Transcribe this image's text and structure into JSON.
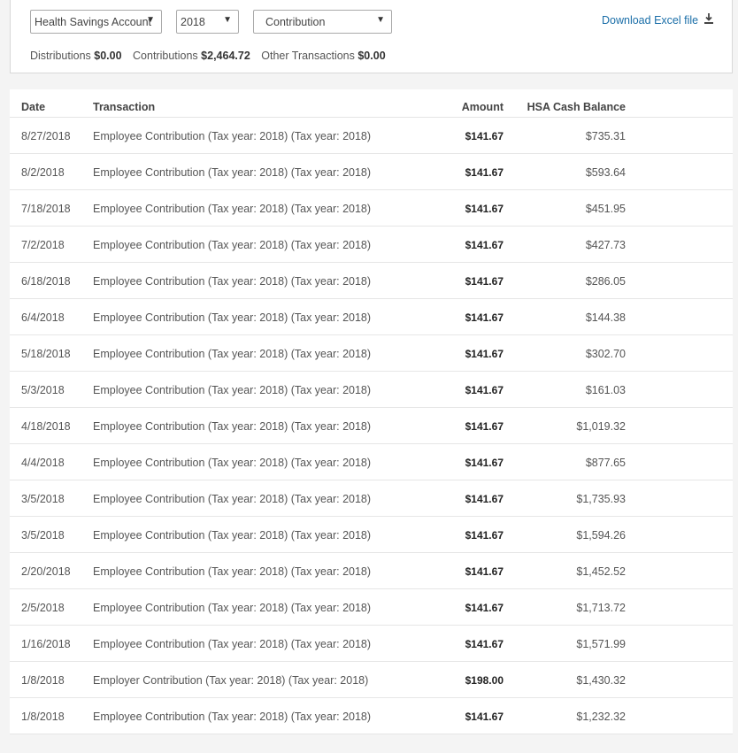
{
  "filters": {
    "account": "Health Savings Account",
    "year": "2018",
    "type": "Contribution"
  },
  "download_label": "Download Excel file",
  "summary": {
    "distributions_label": "Distributions",
    "distributions_value": "$0.00",
    "contributions_label": "Contributions",
    "contributions_value": "$2,464.72",
    "other_label": "Other Transactions",
    "other_value": "$0.00"
  },
  "table": {
    "headers": [
      "Date",
      "Transaction",
      "Amount",
      "HSA Cash Balance"
    ],
    "rows": [
      {
        "date": "8/27/2018",
        "transaction": "Employee Contribution (Tax year: 2018) (Tax year: 2018)",
        "amount": "$141.67",
        "balance": "$735.31"
      },
      {
        "date": "8/2/2018",
        "transaction": "Employee Contribution (Tax year: 2018) (Tax year: 2018)",
        "amount": "$141.67",
        "balance": "$593.64"
      },
      {
        "date": "7/18/2018",
        "transaction": "Employee Contribution (Tax year: 2018) (Tax year: 2018)",
        "amount": "$141.67",
        "balance": "$451.95"
      },
      {
        "date": "7/2/2018",
        "transaction": "Employee Contribution (Tax year: 2018) (Tax year: 2018)",
        "amount": "$141.67",
        "balance": "$427.73"
      },
      {
        "date": "6/18/2018",
        "transaction": "Employee Contribution (Tax year: 2018) (Tax year: 2018)",
        "amount": "$141.67",
        "balance": "$286.05"
      },
      {
        "date": "6/4/2018",
        "transaction": "Employee Contribution (Tax year: 2018) (Tax year: 2018)",
        "amount": "$141.67",
        "balance": "$144.38"
      },
      {
        "date": "5/18/2018",
        "transaction": "Employee Contribution (Tax year: 2018) (Tax year: 2018)",
        "amount": "$141.67",
        "balance": "$302.70"
      },
      {
        "date": "5/3/2018",
        "transaction": "Employee Contribution (Tax year: 2018) (Tax year: 2018)",
        "amount": "$141.67",
        "balance": "$161.03"
      },
      {
        "date": "4/18/2018",
        "transaction": "Employee Contribution (Tax year: 2018) (Tax year: 2018)",
        "amount": "$141.67",
        "balance": "$1,019.32"
      },
      {
        "date": "4/4/2018",
        "transaction": "Employee Contribution (Tax year: 2018) (Tax year: 2018)",
        "amount": "$141.67",
        "balance": "$877.65"
      },
      {
        "date": "3/5/2018",
        "transaction": "Employee Contribution (Tax year: 2018) (Tax year: 2018)",
        "amount": "$141.67",
        "balance": "$1,735.93"
      },
      {
        "date": "3/5/2018",
        "transaction": "Employee Contribution (Tax year: 2018) (Tax year: 2018)",
        "amount": "$141.67",
        "balance": "$1,594.26"
      },
      {
        "date": "2/20/2018",
        "transaction": "Employee Contribution (Tax year: 2018) (Tax year: 2018)",
        "amount": "$141.67",
        "balance": "$1,452.52"
      },
      {
        "date": "2/5/2018",
        "transaction": "Employee Contribution (Tax year: 2018) (Tax year: 2018)",
        "amount": "$141.67",
        "balance": "$1,713.72"
      },
      {
        "date": "1/16/2018",
        "transaction": "Employee Contribution (Tax year: 2018) (Tax year: 2018)",
        "amount": "$141.67",
        "balance": "$1,571.99"
      },
      {
        "date": "1/8/2018",
        "transaction": "Employer Contribution (Tax year: 2018) (Tax year: 2018)",
        "amount": "$198.00",
        "balance": "$1,430.32"
      },
      {
        "date": "1/8/2018",
        "transaction": "Employee Contribution (Tax year: 2018) (Tax year: 2018)",
        "amount": "$141.67",
        "balance": "$1,232.32"
      }
    ]
  }
}
